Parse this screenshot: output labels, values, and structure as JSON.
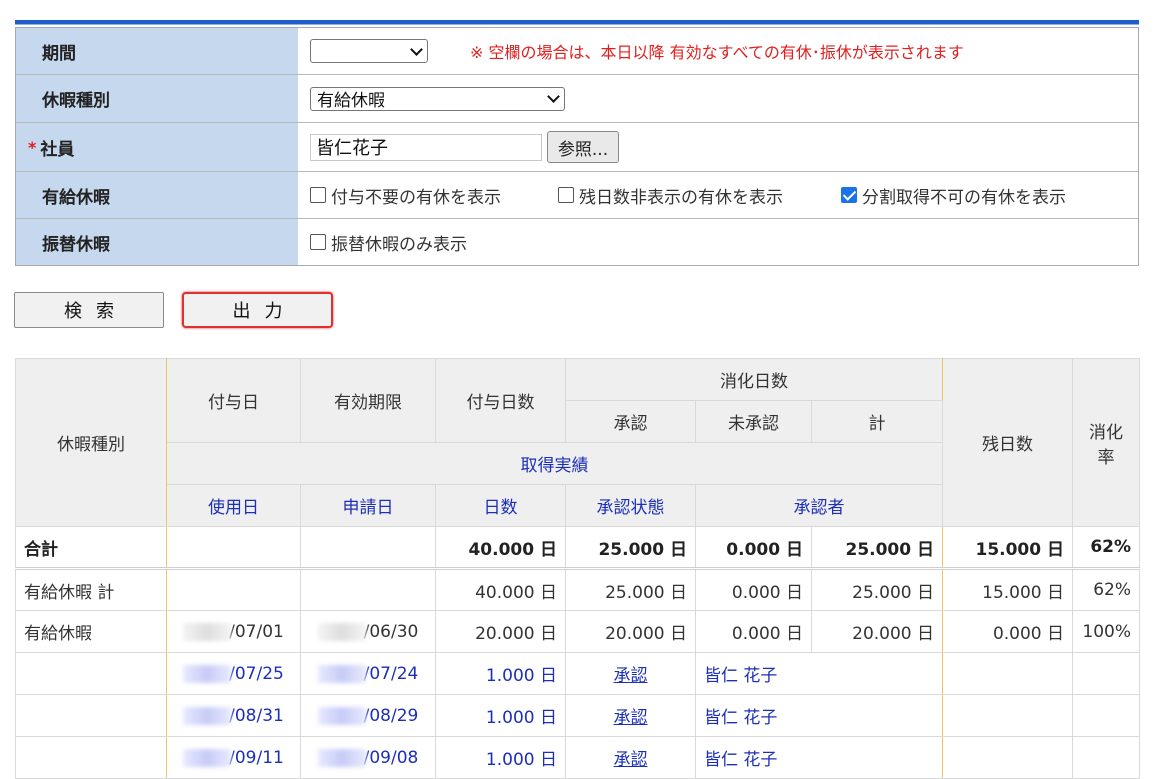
{
  "form": {
    "period": {
      "label": "期間",
      "value": "",
      "notice": "※ 空欄の場合は、本日以降 有効なすべての有休･振休が表示されます"
    },
    "leave_type": {
      "label": "休暇種別",
      "value": "有給休暇"
    },
    "employee": {
      "required_mark": "*",
      "label": "社員",
      "value": "皆仁花子",
      "ref_button": "参照..."
    },
    "paid_leave": {
      "label": "有給休暇",
      "options": [
        {
          "label": "付与不要の有休を表示",
          "checked": false
        },
        {
          "label": "残日数非表示の有休を表示",
          "checked": false
        },
        {
          "label": "分割取得不可の有休を表示",
          "checked": true
        }
      ]
    },
    "substitute_leave": {
      "label": "振替休暇",
      "options": [
        {
          "label": "振替休暇のみ表示",
          "checked": false
        }
      ]
    }
  },
  "buttons": {
    "search": "検索",
    "output": "出力"
  },
  "table": {
    "headers": {
      "leave_type": "休暇種別",
      "grant_date": "付与日",
      "expiry": "有効期限",
      "grant_days": "付与日数",
      "consumed": "消化日数",
      "approved": "承認",
      "unapproved": "未承認",
      "total": "計",
      "remaining": "残日数",
      "rate": "消化率",
      "usage_record": "取得実績",
      "use_date": "使用日",
      "apply_date": "申請日",
      "days": "日数",
      "approval_status": "承認状態",
      "approver": "承認者"
    },
    "total_row": {
      "label": "合計",
      "grant_days": "40.000 日",
      "approved": "25.000 日",
      "unapproved": "0.000 日",
      "total": "25.000 日",
      "remaining": "15.000 日",
      "rate": "62%"
    },
    "sum_row": {
      "label": "有給休暇 計",
      "grant_days": "40.000 日",
      "approved": "25.000 日",
      "unapproved": "0.000 日",
      "total": "25.000 日",
      "remaining": "15.000 日",
      "rate": "62%"
    },
    "grant_row": {
      "label": "有給休暇",
      "grant_date": "/07/01",
      "expiry": "/06/30",
      "grant_days": "20.000 日",
      "approved": "20.000 日",
      "unapproved": "0.000 日",
      "total": "20.000 日",
      "remaining": "0.000 日",
      "rate": "100%"
    },
    "details": [
      {
        "use_date": "/07/25",
        "apply_date": "/07/24",
        "days": "1.000 日",
        "status": "承認",
        "approver": "皆仁 花子"
      },
      {
        "use_date": "/08/31",
        "apply_date": "/08/29",
        "days": "1.000 日",
        "status": "承認",
        "approver": "皆仁 花子"
      },
      {
        "use_date": "/09/11",
        "apply_date": "/09/08",
        "days": "1.000 日",
        "status": "承認",
        "approver": "皆仁 花子"
      }
    ]
  }
}
